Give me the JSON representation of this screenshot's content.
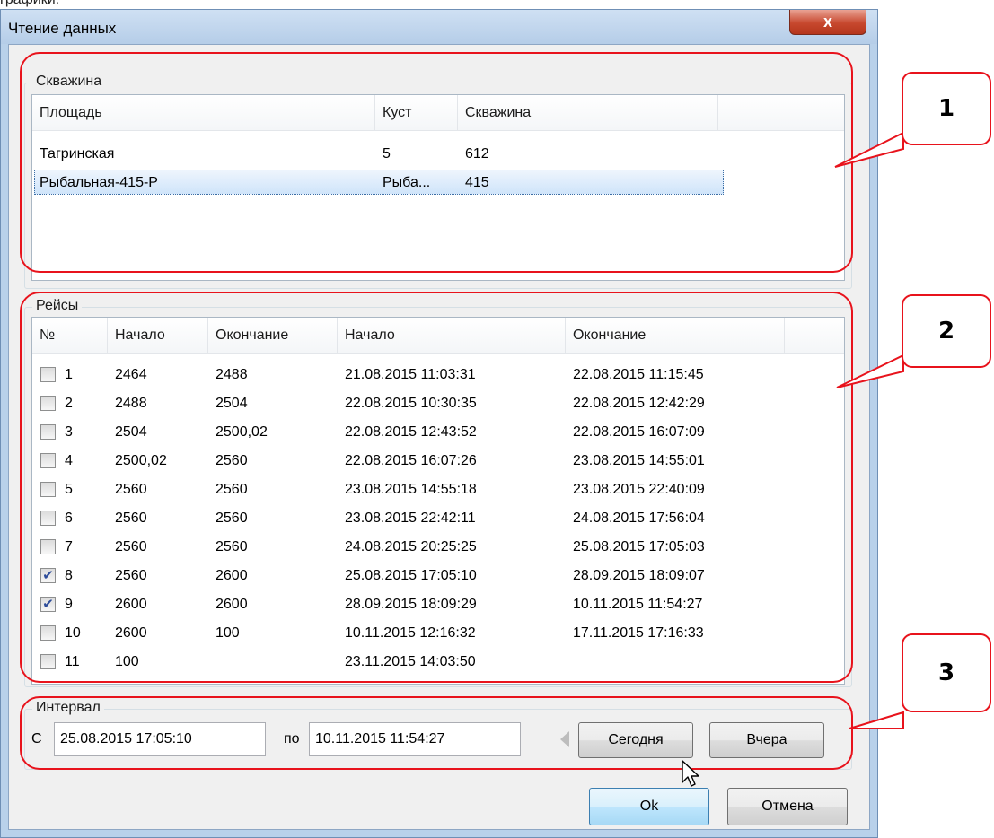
{
  "top_text": "графики:",
  "window": {
    "title": "Чтение данных",
    "close_label": "x"
  },
  "wells": {
    "group_label": "Скважина",
    "columns": [
      "Площадь",
      "Куст",
      "Скважина"
    ],
    "rows": [
      {
        "area": "Тагринская",
        "pad": "5",
        "well": "612",
        "selected": false
      },
      {
        "area": "Рыбальная-415-Р",
        "pad": "Рыба...",
        "well": "415",
        "selected": true
      }
    ]
  },
  "trips": {
    "group_label": "Рейсы",
    "columns": [
      "№",
      "Начало",
      "Окончание",
      "Начало",
      "Окончание"
    ],
    "rows": [
      {
        "num": "1",
        "start_depth": "2464",
        "end_depth": "2488",
        "start_time": "21.08.2015 11:03:31",
        "end_time": "22.08.2015 11:15:45",
        "checked": false
      },
      {
        "num": "2",
        "start_depth": "2488",
        "end_depth": "2504",
        "start_time": "22.08.2015 10:30:35",
        "end_time": "22.08.2015 12:42:29",
        "checked": false
      },
      {
        "num": "3",
        "start_depth": "2504",
        "end_depth": "2500,02",
        "start_time": "22.08.2015 12:43:52",
        "end_time": "22.08.2015 16:07:09",
        "checked": false
      },
      {
        "num": "4",
        "start_depth": "2500,02",
        "end_depth": "2560",
        "start_time": "22.08.2015 16:07:26",
        "end_time": "23.08.2015 14:55:01",
        "checked": false
      },
      {
        "num": "5",
        "start_depth": "2560",
        "end_depth": "2560",
        "start_time": "23.08.2015 14:55:18",
        "end_time": "23.08.2015 22:40:09",
        "checked": false
      },
      {
        "num": "6",
        "start_depth": "2560",
        "end_depth": "2560",
        "start_time": "23.08.2015 22:42:11",
        "end_time": "24.08.2015 17:56:04",
        "checked": false
      },
      {
        "num": "7",
        "start_depth": "2560",
        "end_depth": "2560",
        "start_time": "24.08.2015 20:25:25",
        "end_time": "25.08.2015 17:05:03",
        "checked": false
      },
      {
        "num": "8",
        "start_depth": "2560",
        "end_depth": "2600",
        "start_time": "25.08.2015 17:05:10",
        "end_time": "28.09.2015 18:09:07",
        "checked": true
      },
      {
        "num": "9",
        "start_depth": "2600",
        "end_depth": "2600",
        "start_time": "28.09.2015 18:09:29",
        "end_time": "10.11.2015 11:54:27",
        "checked": true
      },
      {
        "num": "10",
        "start_depth": "2600",
        "end_depth": "100",
        "start_time": "10.11.2015 12:16:32",
        "end_time": "17.11.2015 17:16:33",
        "checked": false
      },
      {
        "num": "11",
        "start_depth": "100",
        "end_depth": "",
        "start_time": "23.11.2015 14:03:50",
        "end_time": "",
        "checked": false
      }
    ]
  },
  "interval": {
    "group_label": "Интервал",
    "from_label": "С",
    "from_value": "25.08.2015 17:05:10",
    "to_label": "по",
    "to_value": "10.11.2015 11:54:27",
    "today_label": "Сегодня",
    "yesterday_label": "Вчера"
  },
  "buttons": {
    "ok_label": "Ok",
    "cancel_label": "Отмена"
  },
  "callouts": [
    {
      "label": "1"
    },
    {
      "label": "2"
    },
    {
      "label": "3"
    }
  ],
  "colors": {
    "callout": "#e8131c",
    "selection": "#cfe4fa",
    "checkmark": "#2d4c9a"
  }
}
